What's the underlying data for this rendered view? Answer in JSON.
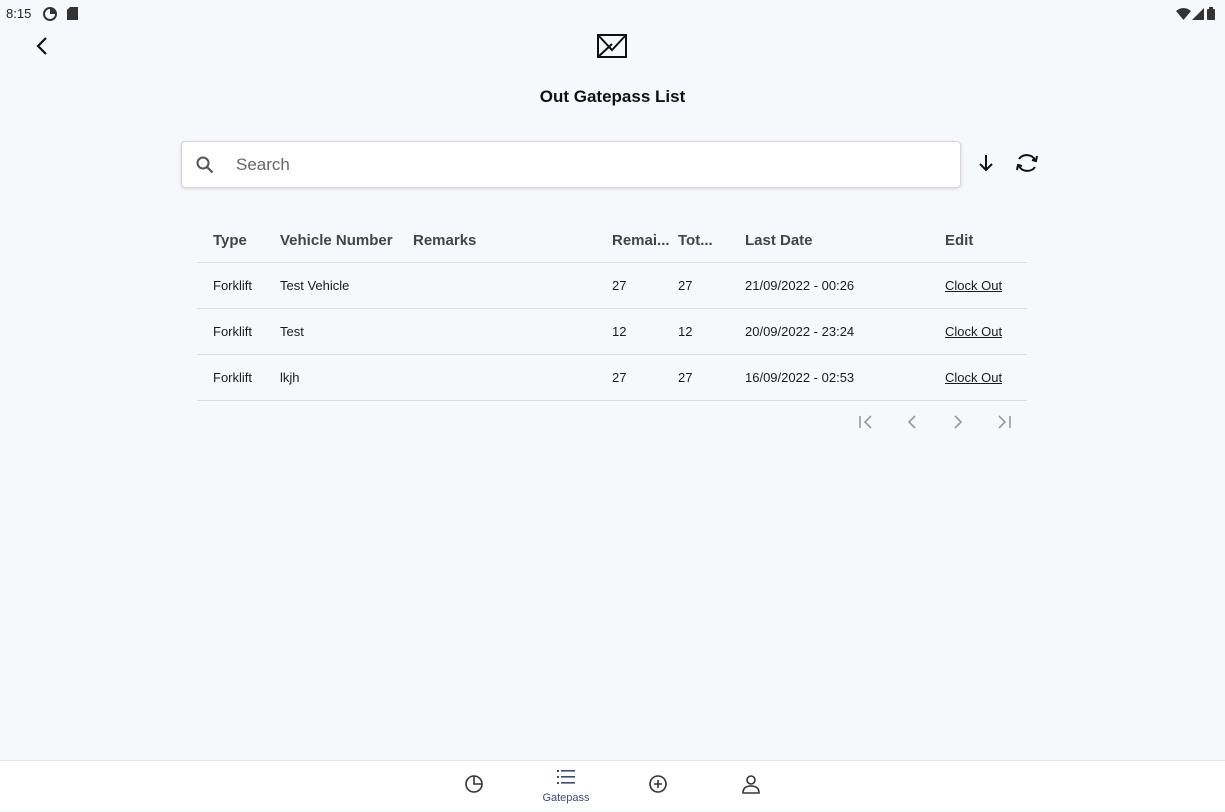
{
  "status_bar": {
    "time": "8:15",
    "icons": [
      "data-saver-icon",
      "sd-card-icon",
      "wifi-icon",
      "signal-icon",
      "battery-icon"
    ]
  },
  "header": {
    "back_icon": "chevron-left-icon",
    "logo_icon": "flag-logo-icon",
    "title": "Out Gatepass List"
  },
  "search": {
    "placeholder": "Search",
    "value": "",
    "sort_icon": "arrow-down-icon",
    "refresh_icon": "refresh-icon"
  },
  "table": {
    "columns": [
      "Type",
      "Vehicle Number",
      "Remarks",
      "Remai...",
      "Tot...",
      "Last Date",
      "Edit"
    ],
    "rows": [
      {
        "type": "Forklift",
        "vehicle": "Test Vehicle",
        "remarks": "",
        "remaining": "27",
        "total": "27",
        "last_date": "21/09/2022 - 00:26",
        "edit": "Clock Out"
      },
      {
        "type": "Forklift",
        "vehicle": "Test",
        "remarks": "",
        "remaining": "12",
        "total": "12",
        "last_date": "20/09/2022 - 23:24",
        "edit": "Clock Out"
      },
      {
        "type": "Forklift",
        "vehicle": "lkjh",
        "remarks": "",
        "remaining": "27",
        "total": "27",
        "last_date": "16/09/2022 - 02:53",
        "edit": "Clock Out"
      }
    ]
  },
  "pagination": {
    "icons": [
      "first-page-icon",
      "previous-page-icon",
      "next-page-icon",
      "last-page-icon"
    ]
  },
  "bottom_nav": {
    "items": [
      {
        "icon": "pie-chart-icon",
        "label": ""
      },
      {
        "icon": "list-icon",
        "label": "Gatepass"
      },
      {
        "icon": "add-circle-icon",
        "label": ""
      },
      {
        "icon": "person-icon",
        "label": ""
      }
    ],
    "active_color": "#3f4a73"
  }
}
